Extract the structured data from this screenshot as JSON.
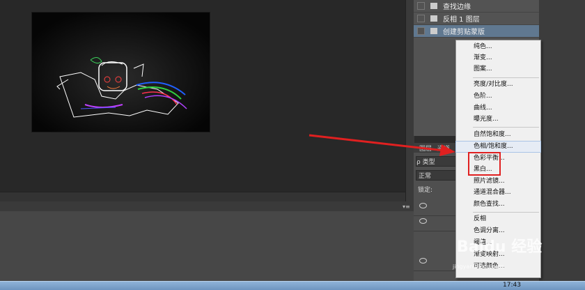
{
  "history": {
    "items": [
      {
        "label": "查找边缘",
        "selected": false
      },
      {
        "label": "反相 1 图层",
        "selected": false
      },
      {
        "label": "创建剪贴蒙版",
        "selected": true
      }
    ]
  },
  "layers_panel": {
    "tabs": [
      "图层",
      "通道"
    ],
    "filter_label": "ρ 类型",
    "blend_mode": "正常",
    "lock_label": "锁定:"
  },
  "adjustment_menu": {
    "groups": [
      [
        "纯色...",
        "渐变...",
        "图案..."
      ],
      [
        "亮度/对比度...",
        "色阶...",
        "曲线...",
        "曝光度..."
      ],
      [
        "自然饱和度...",
        "色相/饱和度...",
        "色彩平衡...",
        "黑白...",
        "照片滤镜...",
        "通道混合器...",
        "颜色查找..."
      ],
      [
        "反相",
        "色调分离...",
        "阈值...",
        "渐变映射...",
        "可选颜色..."
      ]
    ],
    "highlighted": "色相/饱和度..."
  },
  "taskbar": {
    "clock": "17:43"
  },
  "watermark": {
    "text": "Baidu 经验",
    "sub": "jingyan.baidu.com"
  },
  "colors": {
    "menu_bg": "#f0f0f0",
    "selected_row": "#607890",
    "annotation": "#e02020"
  }
}
